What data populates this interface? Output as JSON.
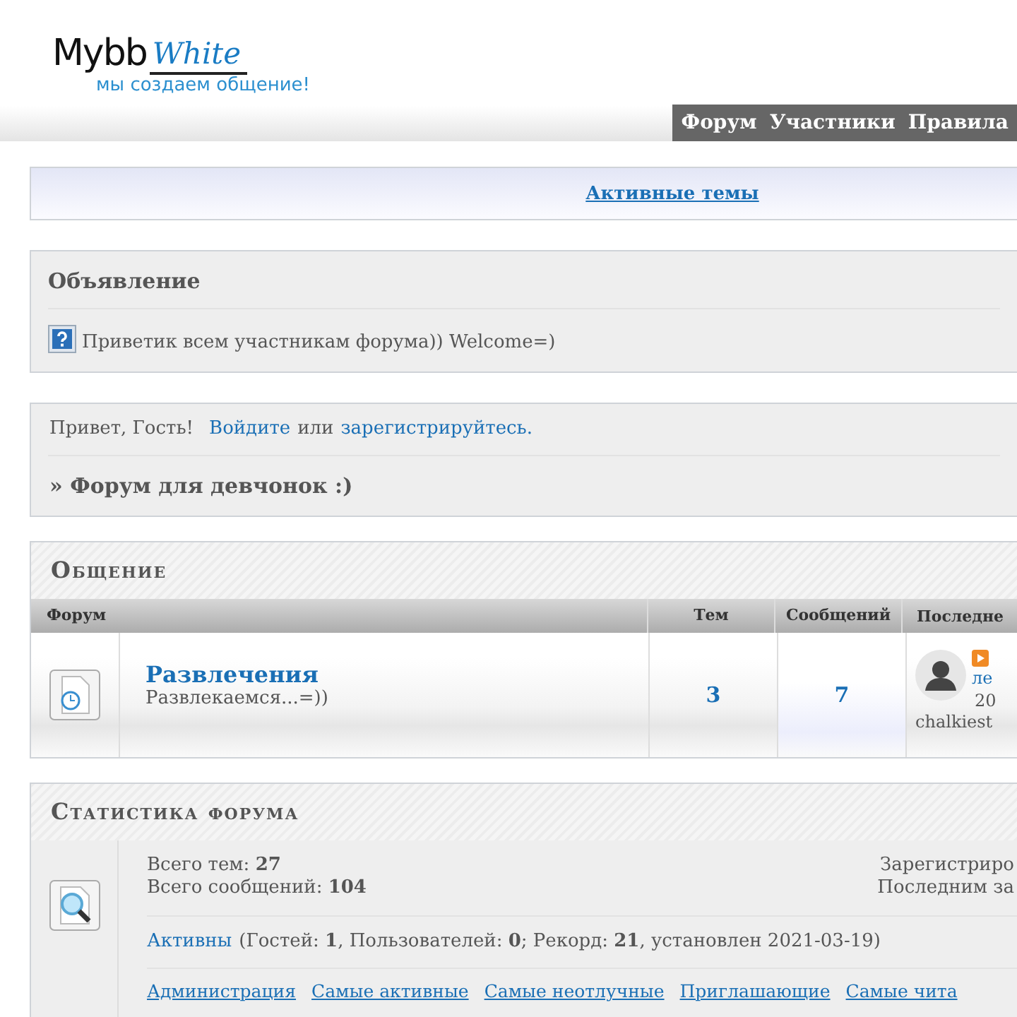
{
  "header": {
    "logo_text": "Mybb",
    "logo_script": "White",
    "tagline": "мы создаем общение!",
    "nav": [
      {
        "label": "Форум"
      },
      {
        "label": "Участники"
      },
      {
        "label": "Правила"
      }
    ]
  },
  "active_topics_link": "Активные темы",
  "announcement": {
    "title": "Объявление",
    "text": "Приветик всем участникам форума)) Welcome=)"
  },
  "welcome": {
    "greeting": "Привет, Гость!",
    "login_link": "Войдите",
    "or": "или",
    "register_link": "зарегистрируйтесь."
  },
  "breadcrumb": "» Форум для девчонок :)",
  "category": {
    "title": "Общение",
    "columns": [
      "Форум",
      "Тем",
      "Сообщений",
      "Последне"
    ],
    "forums": [
      {
        "name": "Развлечения",
        "description": "Развлекаемся...=))",
        "topics": "3",
        "posts": "7",
        "last_post": {
          "title": "ле",
          "date": "20",
          "author": "chalkiest"
        }
      }
    ]
  },
  "stats": {
    "title": "Статистика форума",
    "lines": [
      "Всего тем: **27**",
      "Всего сообщений: **104**"
    ],
    "right_lines": [
      "Зарегистриро",
      "Последним за"
    ],
    "online_link": "Активны",
    "online_text": "(Гостей: **1**, Пользователей: **0**; Рекорд: **21**, установлен 2021-03-19)",
    "links": [
      "Администрация",
      "Самые активные",
      "Самые неотлучные",
      "Приглашающие",
      "Самые чита"
    ]
  }
}
